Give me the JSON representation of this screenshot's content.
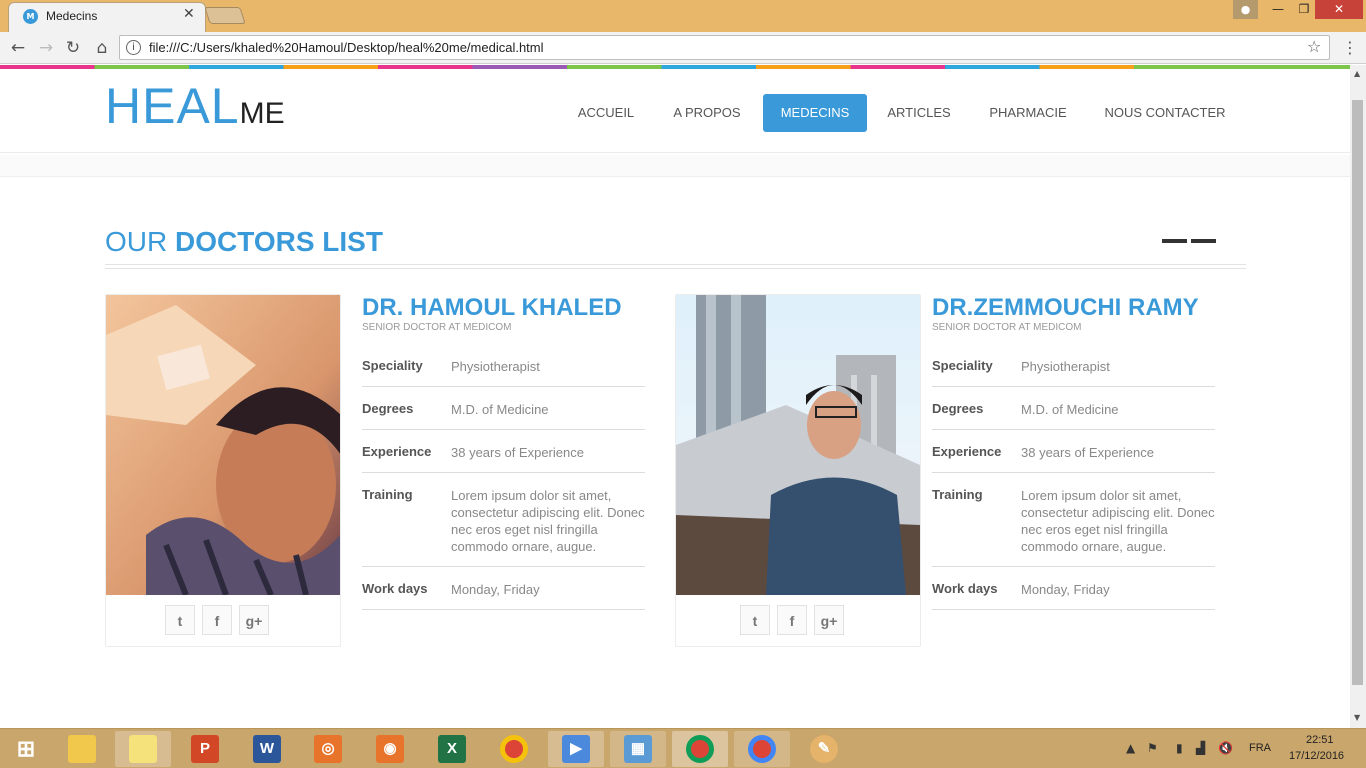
{
  "browser": {
    "tab_title": "Medecins",
    "tab_favicon": "M",
    "url": "file:///C:/Users/khaled%20Hamoul/Desktop/heal%20me/medical.html"
  },
  "site": {
    "logo_main": "HEAL",
    "logo_sub": "ME",
    "nav": [
      "ACCUEIL",
      "A PROPOS",
      "MEDECINS",
      "ARTICLES",
      "PHARMACIE",
      "NOUS CONTACTER"
    ],
    "nav_active": "MEDECINS"
  },
  "section": {
    "title_light": "OUR ",
    "title_bold": "DOCTORS LIST"
  },
  "doctors": [
    {
      "name": "DR. HAMOUL KHALED",
      "role": "SENIOR DOCTOR AT MEDICOM",
      "rows": [
        {
          "label": "Speciality",
          "value": "Physiotherapist"
        },
        {
          "label": "Degrees",
          "value": "M.D. of Medicine"
        },
        {
          "label": "Experience",
          "value": "38 years of Experience"
        },
        {
          "label": "Training",
          "value": "Lorem ipsum dolor sit amet, consectetur adipiscing elit. Donec nec eros eget nisl fringilla commodo ornare, augue."
        },
        {
          "label": "Work days",
          "value": "Monday, Friday"
        }
      ],
      "social": [
        "twitter-icon",
        "facebook-icon",
        "google-plus-icon"
      ]
    },
    {
      "name": "DR.ZEMMOUCHI RAMY",
      "role": "SENIOR DOCTOR AT MEDICOM",
      "rows": [
        {
          "label": "Speciality",
          "value": "Physiotherapist"
        },
        {
          "label": "Degrees",
          "value": "M.D. of Medicine"
        },
        {
          "label": "Experience",
          "value": "38 years of Experience"
        },
        {
          "label": "Training",
          "value": "Lorem ipsum dolor sit amet, consectetur adipiscing elit. Donec nec eros eget nisl fringilla commodo ornare, augue."
        },
        {
          "label": "Work days",
          "value": "Monday, Friday"
        }
      ],
      "social": [
        "twitter-icon",
        "facebook-icon",
        "google-plus-icon"
      ]
    }
  ],
  "taskbar": {
    "language": "FRA",
    "time": "22:51",
    "date": "17/12/2016"
  },
  "colors": {
    "brand": "#3a9ad9",
    "titlebar": "#e9b76a",
    "taskbar": "#c9a66b"
  }
}
